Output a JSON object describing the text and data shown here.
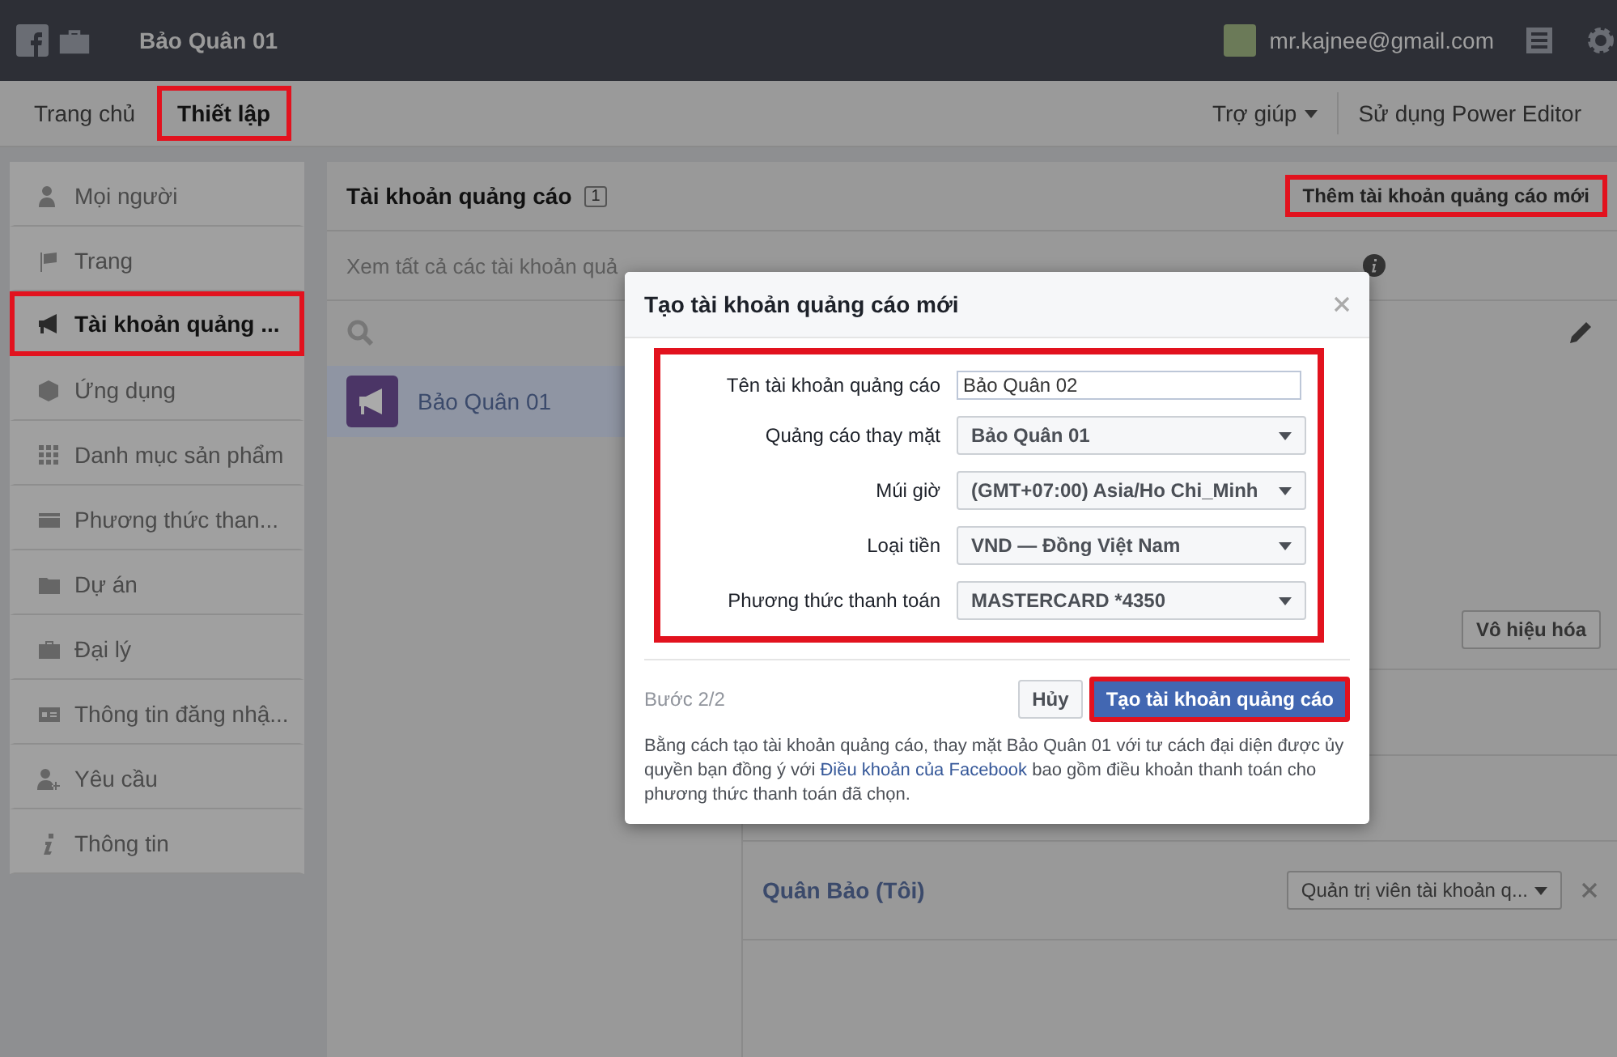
{
  "topbar": {
    "title": "Bảo Quân 01",
    "user": "mr.kajnee@gmail.com"
  },
  "nav_tabs": [
    {
      "label": "Trang chủ",
      "selected": false,
      "annotated": false
    },
    {
      "label": "Thiết lập",
      "selected": true,
      "annotated": true
    }
  ],
  "nav_right": [
    {
      "label": "Trợ giúp",
      "kind": "menu"
    },
    {
      "label": "Sử dụng Power Editor",
      "kind": "link"
    }
  ],
  "sidebar": {
    "items": [
      {
        "label": "Mọi người",
        "selected": false,
        "annotated": false
      },
      {
        "label": "Trang",
        "selected": false,
        "annotated": false
      },
      {
        "label": "Tài khoản quảng ...",
        "selected": true,
        "annotated": true
      },
      {
        "label": "Ứng dụng",
        "selected": false,
        "annotated": false
      },
      {
        "label": "Danh mục sản phẩm",
        "selected": false,
        "annotated": false
      },
      {
        "label": "Phương thức than...",
        "selected": false,
        "annotated": false
      },
      {
        "label": "Dự án",
        "selected": false,
        "annotated": false
      },
      {
        "label": "Đại lý",
        "selected": false,
        "annotated": false
      },
      {
        "label": "Thông tin đăng nhậ...",
        "selected": false,
        "annotated": false
      },
      {
        "label": "Yêu cầu",
        "selected": false,
        "annotated": false
      },
      {
        "label": "Thông tin",
        "selected": false,
        "annotated": false
      }
    ]
  },
  "panel": {
    "title": "Tài khoản quảng cáo",
    "count": "1",
    "add_button": {
      "label": "Thêm tài khoản quảng cáo mới",
      "annotated": true
    },
    "description": "Xem tất cả các tài khoản quả",
    "accounts": [
      {
        "name": "Bảo Quân 01",
        "selected": true
      }
    ],
    "disable_button": "Vô hiệu hóa",
    "people": [
      {
        "name": "Quân Bảo (Tôi)",
        "role": "Quản trị viên tài khoản q..."
      }
    ]
  },
  "dialog": {
    "title": "Tạo tài khoản quảng cáo mới",
    "form_annotated": true,
    "fields": [
      {
        "label": "Tên tài khoản quảng cáo",
        "kind": "text",
        "value": "Bảo Quân 02"
      },
      {
        "label": "Quảng cáo thay mặt",
        "kind": "select",
        "value": "Bảo Quân 01"
      },
      {
        "label": "Múi giờ",
        "kind": "select",
        "value": "(GMT+07:00) Asia/Ho Chi_Minh"
      },
      {
        "label": "Loại tiền",
        "kind": "select",
        "value": "VND — Đồng Việt Nam"
      },
      {
        "label": "Phương thức thanh toán",
        "kind": "select",
        "value": "MASTERCARD *4350"
      }
    ],
    "step": "Bước 2/2",
    "cancel": "Hủy",
    "submit": {
      "label": "Tạo tài khoản quảng cáo",
      "annotated": true
    },
    "legal_before": "Bằng cách tạo tài khoản quảng cáo, thay mặt Bảo Quân 01 với tư cách đại diện được ủy quyền bạn đồng ý với",
    "legal_link": "Điều khoản của Facebook",
    "legal_after": "bao gồm điều khoản thanh toán cho phương thức thanh toán đã chọn."
  }
}
